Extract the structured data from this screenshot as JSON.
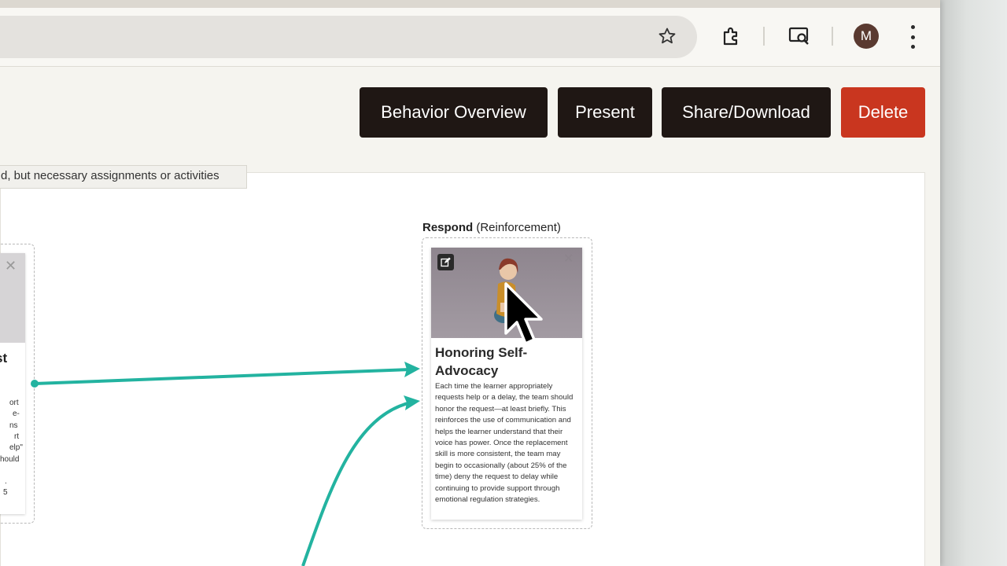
{
  "browser": {
    "avatar_initial": "M"
  },
  "header": {
    "buttons": {
      "behavior_overview": "Behavior Overview",
      "present": "Present",
      "share_download": "Share/Download",
      "delete": "Delete"
    },
    "colors": {
      "primary": "#1f1714",
      "danger": "#c9361f"
    }
  },
  "canvas": {
    "note_text": "d, but necessary assignments or activities",
    "left_card": {
      "title_fragment": "st",
      "orange_fragment": "e",
      "text_fragments": [
        "ort",
        "e-",
        "ns",
        "rt",
        "elp\"",
        "hould",
        ".",
        "5"
      ]
    },
    "respond": {
      "label_bold": "Respond",
      "label_rest": " (Reinforcement)",
      "card": {
        "title": "Honoring Self-Advocacy",
        "description": "Each time the learner appropriately requests help or a delay, the team should honor the request—at least briefly. This reinforces the use of communication and helps the learner understand that their voice has power. Once the replacement skill is more consistent, the team may begin to occasionally (about 25% of the time) deny the request to delay while continuing to provide support through emotional regulation strategies."
      }
    },
    "connector_color": "#23b3a0"
  }
}
